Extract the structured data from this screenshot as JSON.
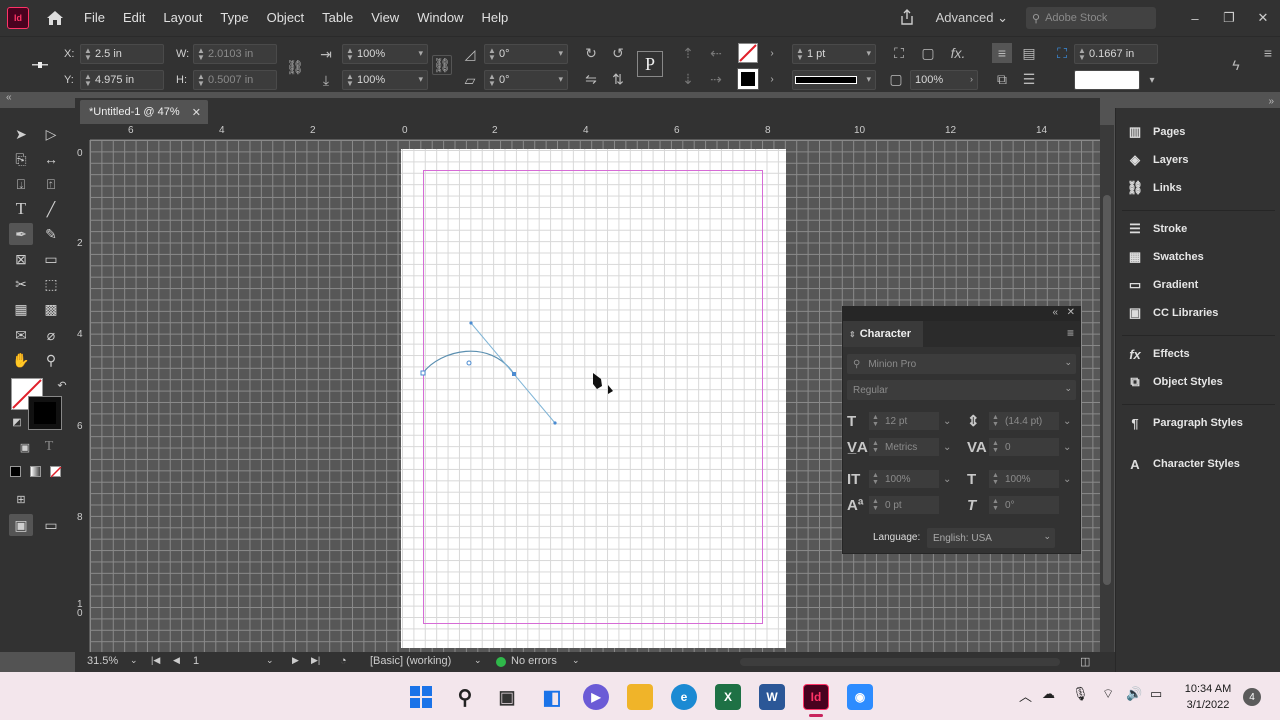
{
  "app": {
    "logo_text": "Id",
    "document_tab": "*Untitled-1 @ 47%"
  },
  "menu": [
    "File",
    "Edit",
    "Layout",
    "Type",
    "Object",
    "Table",
    "View",
    "Window",
    "Help"
  ],
  "header_right": {
    "workspace": "Advanced",
    "search_placeholder": "Adobe Stock"
  },
  "control_bar": {
    "x_label": "X:",
    "x_value": "2.5 in",
    "y_label": "Y:",
    "y_value": "4.975 in",
    "w_label": "W:",
    "w_value": "2.0103 in",
    "h_label": "H:",
    "h_value": "0.5007 in",
    "scale_x": "100%",
    "scale_y": "100%",
    "rotate": "0°",
    "shear": "0°",
    "stroke_weight": "1 pt",
    "opacity": "100%",
    "text_wrap_offset": "0.1667 in"
  },
  "rulers": {
    "horizontal": [
      "6",
      "4",
      "2",
      "0",
      "2",
      "4",
      "6",
      "8",
      "10",
      "12",
      "14"
    ],
    "vertical": [
      "0",
      "2",
      "4",
      "6",
      "8",
      "1\n0"
    ]
  },
  "status_bar": {
    "zoom": "31.5%",
    "page": "1",
    "master": "[Basic] (working)",
    "preflight": "No errors"
  },
  "dock": {
    "items": [
      "Pages",
      "Layers",
      "Links",
      "Stroke",
      "Swatches",
      "Gradient",
      "CC Libraries",
      "Effects",
      "Object Styles",
      "Paragraph Styles",
      "Character Styles"
    ]
  },
  "character_panel": {
    "title": "Character",
    "font_family": "Minion Pro",
    "font_style": "Regular",
    "font_size": "12 pt",
    "leading": "(14.4 pt)",
    "kerning": "Metrics",
    "tracking": "0",
    "vertical_scale": "100%",
    "horizontal_scale": "100%",
    "baseline_shift": "0 pt",
    "skew": "0°",
    "language_label": "Language:",
    "language": "English: USA"
  },
  "taskbar": {
    "time": "10:34 AM",
    "date": "3/1/2022",
    "notifications": "4"
  },
  "colors": {
    "ui_dark": "#323232",
    "canvas": "#535353",
    "accent": "#ff3366",
    "path": "#5b8fb0",
    "margin": "#d66cd6"
  }
}
